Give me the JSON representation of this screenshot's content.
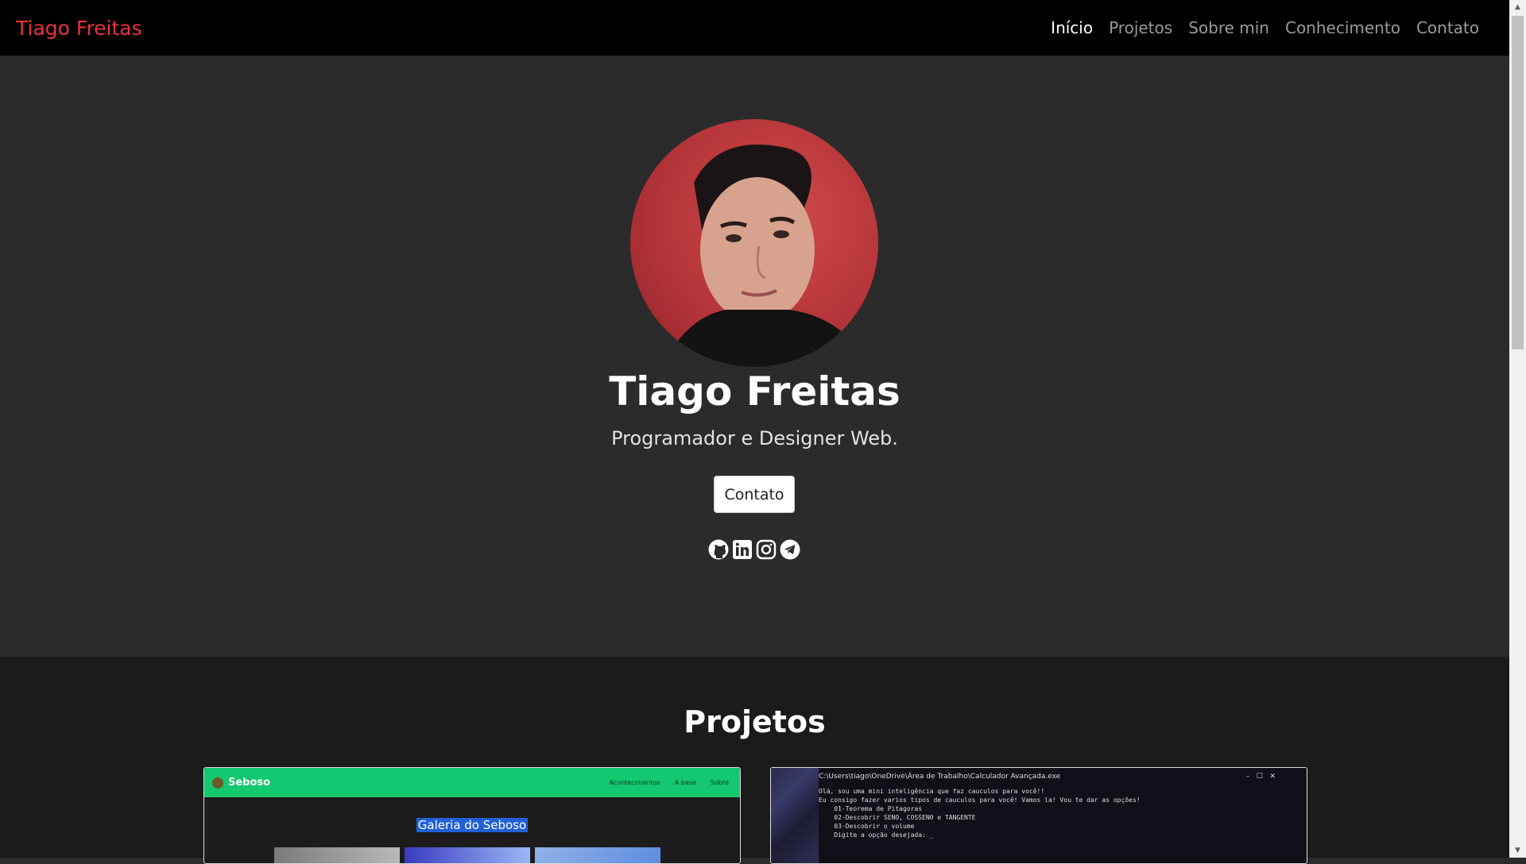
{
  "navbar": {
    "brand": "Tiago Freitas",
    "links": [
      "Início",
      "Projetos",
      "Sobre min",
      "Conhecimento",
      "Contato"
    ],
    "active_index": 0
  },
  "hero": {
    "name": "Tiago Freitas",
    "subtitle": "Programador e Designer Web.",
    "contact_button": "Contato",
    "socials": [
      "github-icon",
      "linkedin-icon",
      "instagram-icon",
      "telegram-icon"
    ]
  },
  "projetos": {
    "title": "Projetos",
    "card1": {
      "brand": "Seboso",
      "links": [
        "Acontecimentos",
        "A base",
        "Sobre"
      ],
      "gallery_title": "Galeria do Seboso"
    },
    "card2": {
      "window_title": "C:\\Users\\tiago\\OneDrive\\Área de Trabalho\\Calculador Avançada.exe",
      "lines": [
        "Olá, sou uma mini inteligência que faz cauculos para você!!",
        "Eu consigo fazer varios tipos de cauculos para você! Vamos la! Vou te dar as opções!",
        "",
        "    01-Teorema de Pitagoras",
        "    02-Descobrir SENO, COSSENO e TANGENTE",
        "    03-Descobrir o volume",
        "    Digite a opção desejada: _"
      ]
    }
  },
  "colors": {
    "brand_red": "#e8323c",
    "hero_bg": "#2b2b2b",
    "projects_bg": "#1b1b1b",
    "seboso_green": "#13c86f"
  }
}
